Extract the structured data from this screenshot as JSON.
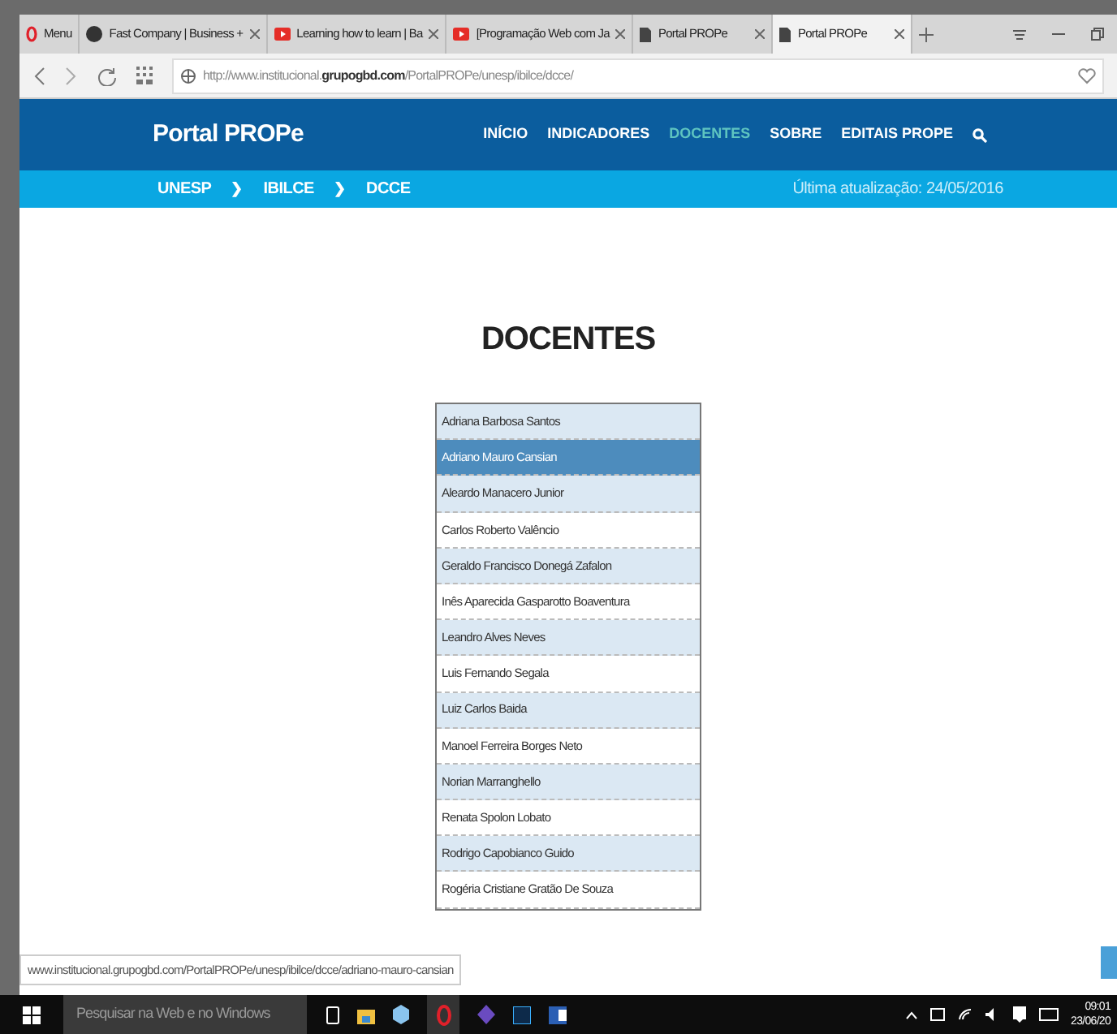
{
  "browser": {
    "tabs": [
      {
        "label": "Menu",
        "kind": "opera",
        "selected": false
      },
      {
        "label": "Fast Company | Business +",
        "kind": "site",
        "selected": false
      },
      {
        "label": "Learning how to learn | Ba",
        "kind": "video",
        "selected": false
      },
      {
        "label": "[Programação Web com Ja",
        "kind": "video",
        "selected": false
      },
      {
        "label": "Portal PROPe",
        "kind": "page",
        "selected": false
      },
      {
        "label": "Portal PROPe",
        "kind": "page",
        "selected": true
      }
    ],
    "address": {
      "prefix": "http://www.institucional.",
      "domain": "grupogbd.com",
      "path": "/PortalPROPe/unesp/ibilce/dcce/"
    },
    "status_url": "www.institucional.grupogbd.com/PortalPROPe/unesp/ibilce/dcce/adriano-mauro-cansian"
  },
  "header": {
    "logo": "Portal PROPe",
    "nav": [
      {
        "label": "INÍCIO",
        "selected": false
      },
      {
        "label": "INDICADORES",
        "selected": false
      },
      {
        "label": "DOCENTES",
        "selected": true
      },
      {
        "label": "SOBRE",
        "selected": false
      },
      {
        "label": "EDITAIS PROPE",
        "selected": false
      }
    ]
  },
  "breadcrumb": {
    "items": [
      "UNESP",
      "IBILCE",
      "DCCE"
    ],
    "separator": "❯",
    "updated": "Última atualização: 24/05/2016"
  },
  "page_title": "DOCENTES",
  "docentes": [
    {
      "name": "Adriana Barbosa Santos",
      "selected": false
    },
    {
      "name": "Adriano Mauro Cansian",
      "selected": true
    },
    {
      "name": "Aleardo Manacero Junior",
      "selected": false
    },
    {
      "name": "Carlos Roberto Valêncio",
      "selected": false
    },
    {
      "name": "Geraldo Francisco Donegá Zafalon",
      "selected": false
    },
    {
      "name": "Inês Aparecida Gasparotto Boaventura",
      "selected": false
    },
    {
      "name": "Leandro Alves Neves",
      "selected": false
    },
    {
      "name": "Luis Fernando Segala",
      "selected": false
    },
    {
      "name": "Luiz Carlos Baida",
      "selected": false
    },
    {
      "name": "Manoel Ferreira Borges Neto",
      "selected": false
    },
    {
      "name": "Norian Marranghello",
      "selected": false
    },
    {
      "name": "Renata Spolon Lobato",
      "selected": false
    },
    {
      "name": "Rodrigo Capobianco Guido",
      "selected": false
    },
    {
      "name": "Rogéria Cristiane Gratão De Souza",
      "selected": false
    }
  ],
  "taskbar": {
    "search_placeholder": "Pesquisar na Web e no Windows",
    "time": "09:01",
    "date": "23/06/20"
  }
}
